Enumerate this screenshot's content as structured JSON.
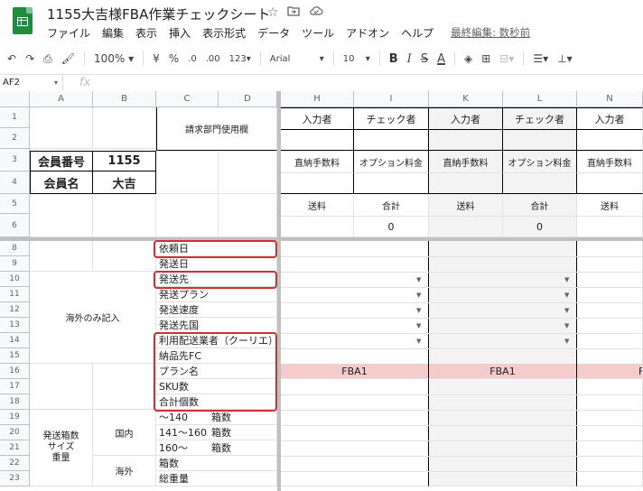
{
  "app": {
    "doc_title": "1155大吉様FBA作業チェックシート",
    "menu": [
      "ファイル",
      "編集",
      "表示",
      "挿入",
      "表示形式",
      "データ",
      "ツール",
      "アドオン",
      "ヘルプ"
    ],
    "last_edit": "最終編集: 数秒前"
  },
  "toolbar": {
    "zoom": "100%",
    "currency": "¥",
    "percent": "%",
    "dec_less": ".0",
    "dec_more": ".00",
    "more_formats": "123",
    "font": "Arial",
    "font_size": "10",
    "bold": "B",
    "italic": "I",
    "strike": "S",
    "text_color": "A"
  },
  "formula_bar": {
    "cell_ref": "AF2",
    "fx": "fx"
  },
  "columns": [
    "A",
    "B",
    "C",
    "D",
    "H",
    "I",
    "K",
    "L",
    "N"
  ],
  "rows": [
    "1",
    "2",
    "3",
    "4",
    "5",
    "6",
    "8",
    "9",
    "10",
    "11",
    "12",
    "13",
    "14",
    "15",
    "16",
    "17",
    "18",
    "19",
    "20",
    "21",
    "22",
    "23"
  ],
  "sheet": {
    "billing_header": "請求部門使用欄",
    "member_no_label": "会員番号",
    "member_no": "1155",
    "member_name_label": "会員名",
    "member_name": "大吉",
    "inputter": "入力者",
    "checker": "チェック者",
    "direct_fee": "直納手数料",
    "option_fee": "オプション料金",
    "shipping": "送料",
    "total": "合計",
    "total_value": "0",
    "overseas_only": "海外のみ記入",
    "items": [
      "依頼日",
      "発送日",
      "発送先",
      "発送プラン",
      "発送速度",
      "発送先国",
      "利用配送業者（クーリエ）",
      "納品先FC",
      "プラン名",
      "SKU数",
      "合計個数"
    ],
    "box_size_label": "発送箱数\nサイズ\n重量",
    "domestic": "国内",
    "overseas": "海外",
    "size_rows": [
      {
        "range": "～140",
        "unit": "箱数"
      },
      {
        "range": "141～160",
        "unit": "箱数"
      },
      {
        "range": "160～",
        "unit": "箱数"
      },
      {
        "range": "箱数",
        "unit": ""
      },
      {
        "range": "総重量",
        "unit": ""
      }
    ],
    "plan_value": "FBA1"
  },
  "colors": {
    "red_highlight": "#d32f2f",
    "pink_fill": "#f4cccc",
    "grey_fill": "#f3f3f3",
    "sheets_green": "#1e8e3e"
  }
}
